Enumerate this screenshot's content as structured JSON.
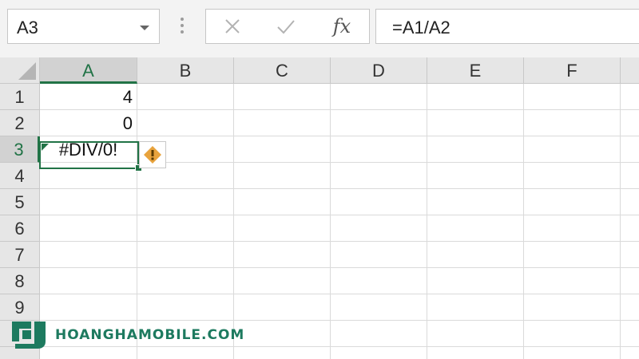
{
  "formula_bar": {
    "name_box": "A3",
    "cancel_icon": "close-icon",
    "enter_icon": "check-icon",
    "fx_label": "fx",
    "formula": "=A1/A2"
  },
  "grid": {
    "columns": [
      "A",
      "B",
      "C",
      "D",
      "E",
      "F"
    ],
    "rows": [
      "1",
      "2",
      "3",
      "4",
      "5",
      "6",
      "7",
      "8",
      "9"
    ],
    "active_cell": "A3",
    "cells": {
      "A1": "4",
      "A2": "0",
      "A3": "#DIV/0!"
    },
    "error_icon": "warning-icon"
  },
  "watermark": {
    "text": "HOANGHAMOBILE.COM"
  },
  "colors": {
    "accent": "#217346",
    "warning": "#e8a33d",
    "watermark": "#1d7a5f"
  }
}
